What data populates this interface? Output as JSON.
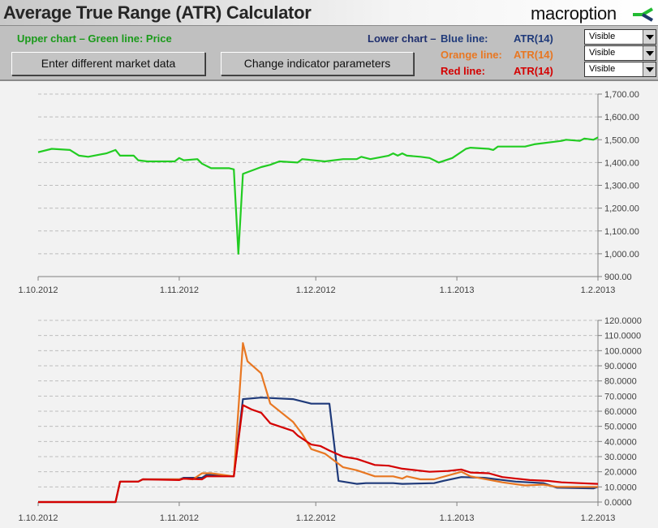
{
  "header": {
    "title": "Average True Range (ATR) Calculator",
    "logo": "macroption"
  },
  "panel": {
    "upper_legend": "Upper chart – Green line: Price",
    "lower_prefix": "Lower chart –",
    "lines": [
      {
        "label": "Blue line:",
        "indicator": "ATR(14)",
        "visibility": "Visible",
        "color": "#1f3a7a"
      },
      {
        "label": "Orange line:",
        "indicator": "ATR(14)",
        "visibility": "Visible",
        "color": "#e87722"
      },
      {
        "label": "Red line:",
        "indicator": "ATR(14)",
        "visibility": "Visible",
        "color": "#d40000"
      }
    ],
    "buttons": {
      "market_data": "Enter different market data",
      "parameters": "Change indicator parameters"
    }
  },
  "colors": {
    "price": "#22cc22",
    "upper_legend": "#1a9a1a",
    "lower_prefix": "#1f2f6e"
  },
  "chart_data": [
    {
      "type": "line",
      "x_ticks": [
        "1.10.2012",
        "1.11.2012",
        "1.12.2012",
        "1.1.2013",
        "1.2.2013"
      ],
      "x_tick_dates": [
        "2012-10-01",
        "2012-11-01",
        "2012-12-01",
        "2013-01-01",
        "2013-02-01"
      ],
      "xlim": [
        "2012-10-01",
        "2013-02-01"
      ],
      "ylim": [
        900,
        1700
      ],
      "y_ticks": [
        "900.00",
        "1,000.00",
        "1,100.00",
        "1,200.00",
        "1,300.00",
        "1,400.00",
        "1,500.00",
        "1,600.00",
        "1,700.00"
      ],
      "grid": true,
      "y_axis": "right",
      "series": [
        {
          "color": "#22cc22",
          "points": [
            [
              "2012-10-01",
              1445
            ],
            [
              "2012-10-04",
              1460
            ],
            [
              "2012-10-08",
              1455
            ],
            [
              "2012-10-10",
              1430
            ],
            [
              "2012-10-12",
              1425
            ],
            [
              "2012-10-16",
              1440
            ],
            [
              "2012-10-18",
              1455
            ],
            [
              "2012-10-19",
              1430
            ],
            [
              "2012-10-22",
              1430
            ],
            [
              "2012-10-23",
              1410
            ],
            [
              "2012-10-25",
              1405
            ],
            [
              "2012-10-31",
              1405
            ],
            [
              "2012-11-01",
              1420
            ],
            [
              "2012-11-02",
              1410
            ],
            [
              "2012-11-05",
              1415
            ],
            [
              "2012-11-06",
              1395
            ],
            [
              "2012-11-08",
              1375
            ],
            [
              "2012-11-12",
              1375
            ],
            [
              "2012-11-13",
              1370
            ],
            [
              "2012-11-14",
              1000
            ],
            [
              "2012-11-15",
              1350
            ],
            [
              "2012-11-19",
              1380
            ],
            [
              "2012-11-21",
              1390
            ],
            [
              "2012-11-23",
              1405
            ],
            [
              "2012-11-27",
              1400
            ],
            [
              "2012-11-28",
              1415
            ],
            [
              "2012-12-03",
              1405
            ],
            [
              "2012-12-07",
              1415
            ],
            [
              "2012-12-10",
              1415
            ],
            [
              "2012-12-11",
              1425
            ],
            [
              "2012-12-13",
              1415
            ],
            [
              "2012-12-17",
              1430
            ],
            [
              "2012-12-18",
              1440
            ],
            [
              "2012-12-19",
              1430
            ],
            [
              "2012-12-20",
              1440
            ],
            [
              "2012-12-21",
              1430
            ],
            [
              "2012-12-24",
              1425
            ],
            [
              "2012-12-26",
              1420
            ],
            [
              "2012-12-28",
              1400
            ],
            [
              "2012-12-31",
              1420
            ],
            [
              "2013-01-03",
              1460
            ],
            [
              "2013-01-04",
              1465
            ],
            [
              "2013-01-08",
              1460
            ],
            [
              "2013-01-09",
              1455
            ],
            [
              "2013-01-10",
              1470
            ],
            [
              "2013-01-16",
              1470
            ],
            [
              "2013-01-18",
              1480
            ],
            [
              "2013-01-24",
              1495
            ],
            [
              "2013-01-25",
              1500
            ],
            [
              "2013-01-28",
              1495
            ],
            [
              "2013-01-29",
              1505
            ],
            [
              "2013-01-31",
              1500
            ],
            [
              "2013-02-01",
              1510
            ]
          ]
        }
      ]
    },
    {
      "type": "line",
      "x_ticks": [
        "1.10.2012",
        "1.11.2012",
        "1.12.2012",
        "1.1.2013",
        "1.2.2013"
      ],
      "x_tick_dates": [
        "2012-10-01",
        "2012-11-01",
        "2012-12-01",
        "2013-01-01",
        "2013-02-01"
      ],
      "xlim": [
        "2012-10-01",
        "2013-02-01"
      ],
      "ylim": [
        0,
        120
      ],
      "y_ticks": [
        "0.0000",
        "10.0000",
        "20.0000",
        "30.0000",
        "40.0000",
        "50.0000",
        "60.0000",
        "70.0000",
        "80.0000",
        "90.0000",
        "100.0000",
        "110.0000",
        "120.0000"
      ],
      "grid": true,
      "y_axis": "right",
      "series": [
        {
          "color": "#1f3a7a",
          "points": [
            [
              "2012-10-01",
              0
            ],
            [
              "2012-10-18",
              0
            ],
            [
              "2012-10-19",
              13.5
            ],
            [
              "2012-10-23",
              13.5
            ],
            [
              "2012-10-24",
              15
            ],
            [
              "2012-11-01",
              15
            ],
            [
              "2012-11-02",
              16
            ],
            [
              "2012-11-06",
              16
            ],
            [
              "2012-11-07",
              18
            ],
            [
              "2012-11-13",
              17
            ],
            [
              "2012-11-15",
              68
            ],
            [
              "2012-11-19",
              69
            ],
            [
              "2012-11-26",
              68
            ],
            [
              "2012-11-30",
              65
            ],
            [
              "2012-12-04",
              65
            ],
            [
              "2012-12-06",
              14
            ],
            [
              "2012-12-10",
              12
            ],
            [
              "2012-12-12",
              12.5
            ],
            [
              "2012-12-18",
              12.5
            ],
            [
              "2012-12-20",
              12
            ],
            [
              "2012-12-27",
              12.5
            ],
            [
              "2012-12-29",
              14
            ],
            [
              "2013-01-02",
              16.5
            ],
            [
              "2013-01-07",
              16
            ],
            [
              "2013-01-14",
              13.5
            ],
            [
              "2013-01-20",
              12.5
            ],
            [
              "2013-01-23",
              9.5
            ],
            [
              "2013-01-31",
              9
            ],
            [
              "2013-02-01",
              10
            ]
          ]
        },
        {
          "color": "#e87722",
          "points": [
            [
              "2012-10-01",
              0
            ],
            [
              "2012-10-18",
              0
            ],
            [
              "2012-10-19",
              13.5
            ],
            [
              "2012-10-23",
              13.5
            ],
            [
              "2012-10-24",
              15
            ],
            [
              "2012-11-01",
              15
            ],
            [
              "2012-11-02",
              15.5
            ],
            [
              "2012-11-04",
              15
            ],
            [
              "2012-11-06",
              19
            ],
            [
              "2012-11-08",
              19
            ],
            [
              "2012-11-13",
              17
            ],
            [
              "2012-11-15",
              105
            ],
            [
              "2012-11-16",
              93
            ],
            [
              "2012-11-19",
              85
            ],
            [
              "2012-11-21",
              65
            ],
            [
              "2012-11-26",
              53
            ],
            [
              "2012-11-28",
              45
            ],
            [
              "2012-11-30",
              35
            ],
            [
              "2012-12-03",
              32
            ],
            [
              "2012-12-07",
              23
            ],
            [
              "2012-12-10",
              21
            ],
            [
              "2012-12-14",
              17
            ],
            [
              "2012-12-18",
              17
            ],
            [
              "2012-12-20",
              15.5
            ],
            [
              "2012-12-21",
              17
            ],
            [
              "2012-12-24",
              15
            ],
            [
              "2012-12-27",
              15
            ],
            [
              "2013-01-02",
              20
            ],
            [
              "2013-01-04",
              17
            ],
            [
              "2013-01-11",
              13
            ],
            [
              "2013-01-16",
              11
            ],
            [
              "2013-01-20",
              11.5
            ],
            [
              "2013-01-23",
              10
            ],
            [
              "2013-01-30",
              10
            ],
            [
              "2013-02-01",
              10
            ]
          ]
        },
        {
          "color": "#d40000",
          "points": [
            [
              "2012-10-01",
              0
            ],
            [
              "2012-10-18",
              0
            ],
            [
              "2012-10-19",
              13.5
            ],
            [
              "2012-10-23",
              13.5
            ],
            [
              "2012-10-24",
              15
            ],
            [
              "2012-11-01",
              14.5
            ],
            [
              "2012-11-02",
              15.5
            ],
            [
              "2012-11-06",
              15
            ],
            [
              "2012-11-07",
              17
            ],
            [
              "2012-11-13",
              17
            ],
            [
              "2012-11-15",
              64
            ],
            [
              "2012-11-17",
              61
            ],
            [
              "2012-11-19",
              59
            ],
            [
              "2012-11-21",
              52
            ],
            [
              "2012-11-26",
              47
            ],
            [
              "2012-11-27",
              44
            ],
            [
              "2012-11-30",
              38
            ],
            [
              "2012-12-02",
              37
            ],
            [
              "2012-12-04",
              34
            ],
            [
              "2012-12-07",
              30
            ],
            [
              "2012-12-10",
              28.5
            ],
            [
              "2012-12-14",
              24.5
            ],
            [
              "2012-12-17",
              24
            ],
            [
              "2012-12-20",
              22
            ],
            [
              "2012-12-26",
              20
            ],
            [
              "2012-12-30",
              20.5
            ],
            [
              "2013-01-02",
              21.5
            ],
            [
              "2013-01-04",
              19.5
            ],
            [
              "2013-01-08",
              19
            ],
            [
              "2013-01-11",
              16.5
            ],
            [
              "2013-01-17",
              14.5
            ],
            [
              "2013-01-21",
              14
            ],
            [
              "2013-01-24",
              13
            ],
            [
              "2013-01-28",
              12.5
            ],
            [
              "2013-02-01",
              12
            ]
          ]
        }
      ]
    }
  ]
}
